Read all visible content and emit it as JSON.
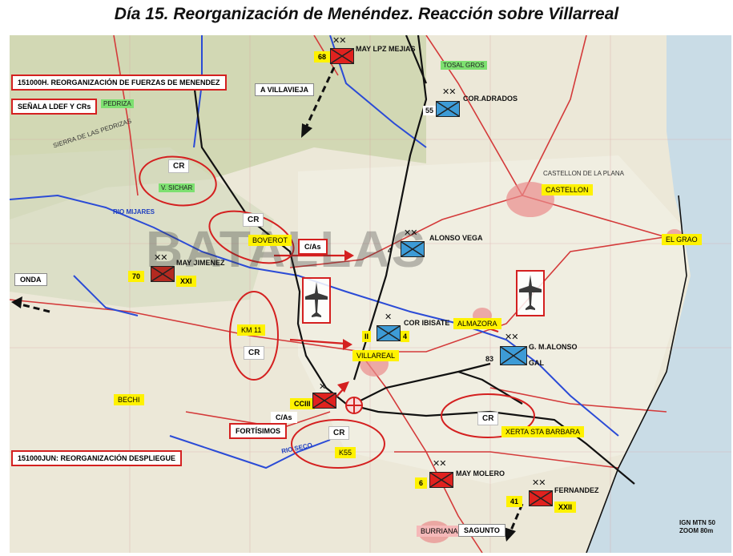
{
  "title": "Día 15. Reorganización de Menéndez. Reacción sobre Villarreal",
  "boxes": {
    "reorg_fuerzas": "151000H. REORGANIZACIÓN DE FUERZAS DE MENENDEZ",
    "senala": "SEÑALA LDEF Y CRs",
    "reorg_despliegue": "151000JUN: REORGANIZACIÓN DESPLIEGUE",
    "fortisimos": "FORTÍSIMOS",
    "cas_top": "C/As",
    "cas_bottom": "C/As"
  },
  "directions": {
    "a_villavieja": "A VILLAVIEJA",
    "onda": "ONDA",
    "sagunto": "SAGUNTO"
  },
  "cr_label": "CR",
  "units": {
    "may_lpz_mejias": {
      "number": "68",
      "name": "MAY LPZ MEJIAS",
      "echelon": "✕✕"
    },
    "cor_adrados": {
      "number": "55",
      "name": "COR.ADRADOS",
      "echelon": "✕✕"
    },
    "may_jimenez": {
      "number": "70",
      "name": "MAY JIMENEZ",
      "corps": "XXI",
      "echelon": "✕✕"
    },
    "alonso_vega": {
      "number": "4",
      "name": "ALONSO VEGA",
      "echelon": "✕✕"
    },
    "cor_ibisate": {
      "number": "4",
      "name": "COR IBISATE",
      "prefix": "II",
      "echelon": "✕"
    },
    "g_alonso": {
      "number": "83",
      "name": "G. M.ALONSO",
      "sub": "GAL",
      "echelon": "✕✕"
    },
    "cciii": {
      "name": "CCIII",
      "echelon": "✕"
    },
    "may_molero": {
      "number": "6",
      "name": "MAY MOLERO",
      "echelon": "✕✕"
    },
    "fernandez": {
      "number": "41",
      "name": "FERNANDEZ",
      "corps": "XXII",
      "echelon": "✕✕"
    }
  },
  "places_yellow": {
    "boverot": "BOVEROT",
    "km11": "KM 11",
    "villareal": "VILLAREAL",
    "almazora": "ALMAZORA",
    "castellon": "CASTELLON",
    "el_grao": "EL GRAO",
    "bechi": "BECHI",
    "k55": "K55",
    "xerta": "XERTA STA BARBARA",
    "burriana": "BURRIANA"
  },
  "places_green": {
    "pedriza": "PEDRIZA",
    "v_sichar": "V. SICHAR",
    "rio_mijares": "RIO MIJARES",
    "tosal_gros": "TOSAL GROS",
    "rio_seco": "RIO SECO"
  },
  "places_map": {
    "sierra": "SIERRA DE LAS PEDRIZAS",
    "castellon_map": "CASTELLON DE LA PLANA"
  },
  "watermark": "BATALLAS",
  "ign": {
    "line1": "IGN MTN 50",
    "line2": "ZOOM 80m"
  },
  "colors": {
    "friendly_blue": "#3d9bd6",
    "enemy_red": "#e0221f",
    "line_red": "#d42020",
    "front_black": "#111111",
    "river_blue": "#2b4bd6",
    "sea": "#c9dce6"
  }
}
